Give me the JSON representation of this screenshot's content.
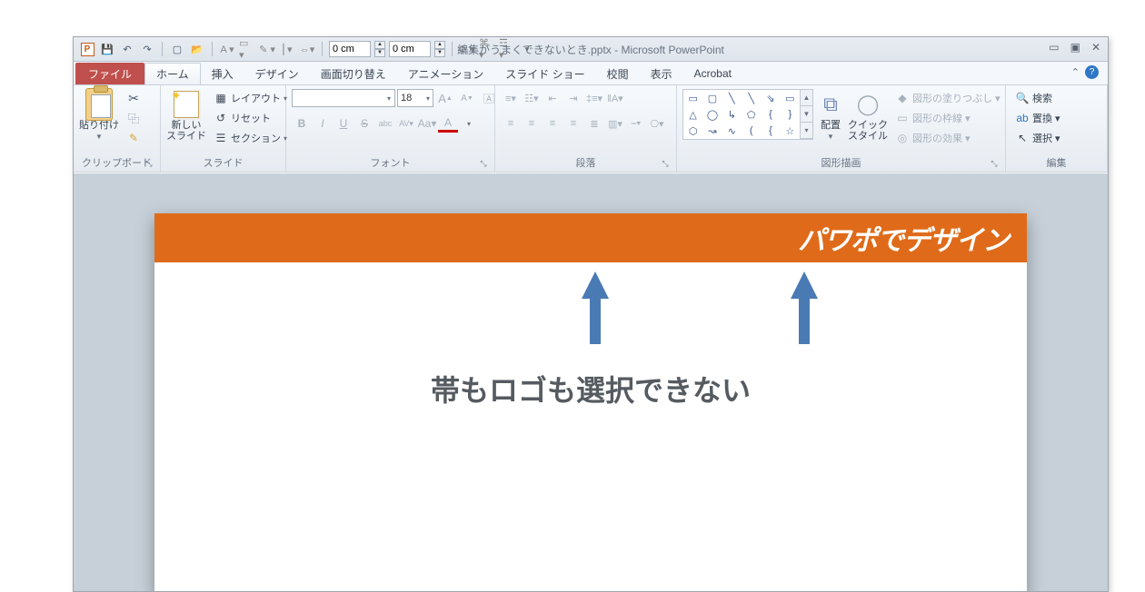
{
  "title": "編集がうまくできないとき.pptx - Microsoft PowerPoint",
  "qat": {
    "width_val": "0 cm",
    "height_val": "0 cm"
  },
  "tabs": {
    "file": "ファイル",
    "items": [
      "ホーム",
      "挿入",
      "デザイン",
      "画面切り替え",
      "アニメーション",
      "スライド ショー",
      "校閲",
      "表示",
      "Acrobat"
    ],
    "active": 0
  },
  "ribbon": {
    "clipboard": {
      "label": "クリップボード",
      "paste": "貼り付け"
    },
    "slides": {
      "label": "スライド",
      "newslide": "新しい\nスライド",
      "layout": "レイアウト",
      "reset": "リセット",
      "section": "セクション"
    },
    "font": {
      "label": "フォント",
      "size": "18",
      "grow": "A",
      "shrink": "A",
      "clear": "A",
      "bold": "B",
      "italic": "I",
      "under": "U",
      "strike": "S",
      "shadow": "abc",
      "spacing": "AV",
      "case": "Aa",
      "color": "A"
    },
    "paragraph": {
      "label": "段落"
    },
    "drawing": {
      "label": "図形描画",
      "arrange": "配置",
      "quickstyle": "クイック\nスタイル",
      "fill": "図形の塗りつぶし",
      "outline": "図形の枠線",
      "effects": "図形の効果"
    },
    "editing": {
      "label": "編集",
      "find": "検索",
      "replace": "置換",
      "select": "選択"
    }
  },
  "slide": {
    "band_text": "パワポでデザイン",
    "caption": "帯もロゴも選択できない"
  }
}
